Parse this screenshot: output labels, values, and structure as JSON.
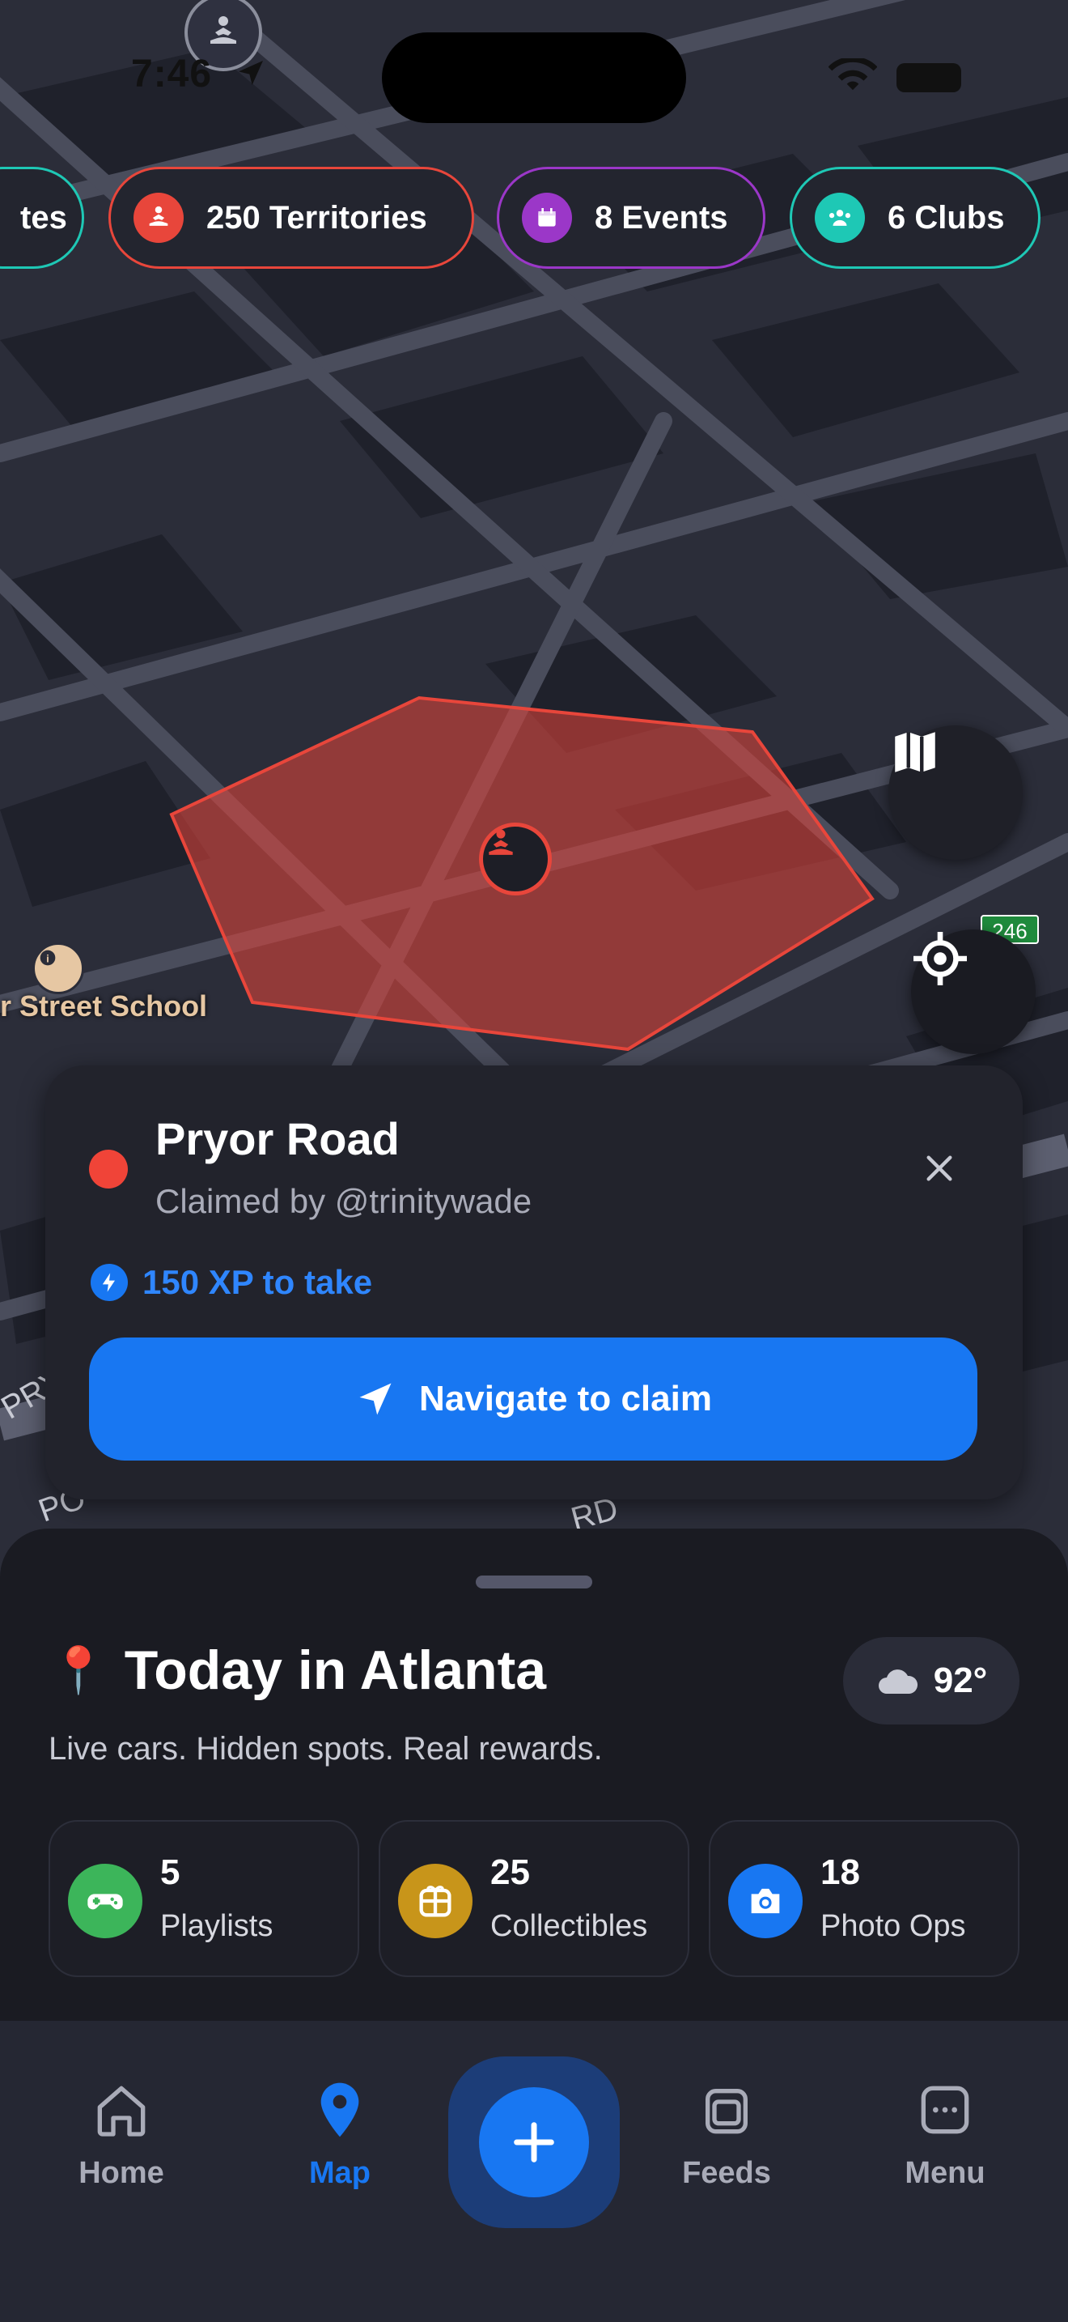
{
  "status": {
    "time": "7:46"
  },
  "chips": [
    {
      "label": "tes",
      "color": "#1ec8b5"
    },
    {
      "label": "250 Territories",
      "color": "#e8463b"
    },
    {
      "label": "8 Events",
      "color": "#9b37c8"
    },
    {
      "label": "6 Clubs",
      "color": "#1ec8b5"
    }
  ],
  "map": {
    "school_label": "r Street School",
    "highway_shield": "246",
    "street_partial_1": "PRY",
    "street_partial_2": "PO",
    "street_partial_3": "RD"
  },
  "territory_card": {
    "title": "Pryor Road",
    "claimed_by": "Claimed by @trinitywade",
    "xp": "150 XP to take",
    "navigate_label": "Navigate to claim",
    "status_color": "#f04438"
  },
  "today": {
    "pin": "📍",
    "title": "Today in Atlanta",
    "weather": "92°",
    "subtitle": "Live cars. Hidden spots. Real rewards.",
    "stats": [
      {
        "value": "5",
        "label": "Playlists",
        "icon": "gamepad-icon",
        "color": "#3cb55a"
      },
      {
        "value": "25",
        "label": "Collectibles",
        "icon": "gift-icon",
        "color": "#c8951a"
      },
      {
        "value": "18",
        "label": "Photo Ops",
        "icon": "camera-icon",
        "color": "#1877f2"
      }
    ]
  },
  "tabs": [
    {
      "label": "Home",
      "icon": "home-icon"
    },
    {
      "label": "Map",
      "icon": "map-pin-icon",
      "active": true
    },
    {
      "label": "Feeds",
      "icon": "feeds-icon"
    },
    {
      "label": "Menu",
      "icon": "menu-icon"
    }
  ],
  "colors": {
    "accent": "#1877f2",
    "territory": "#e8463b"
  }
}
